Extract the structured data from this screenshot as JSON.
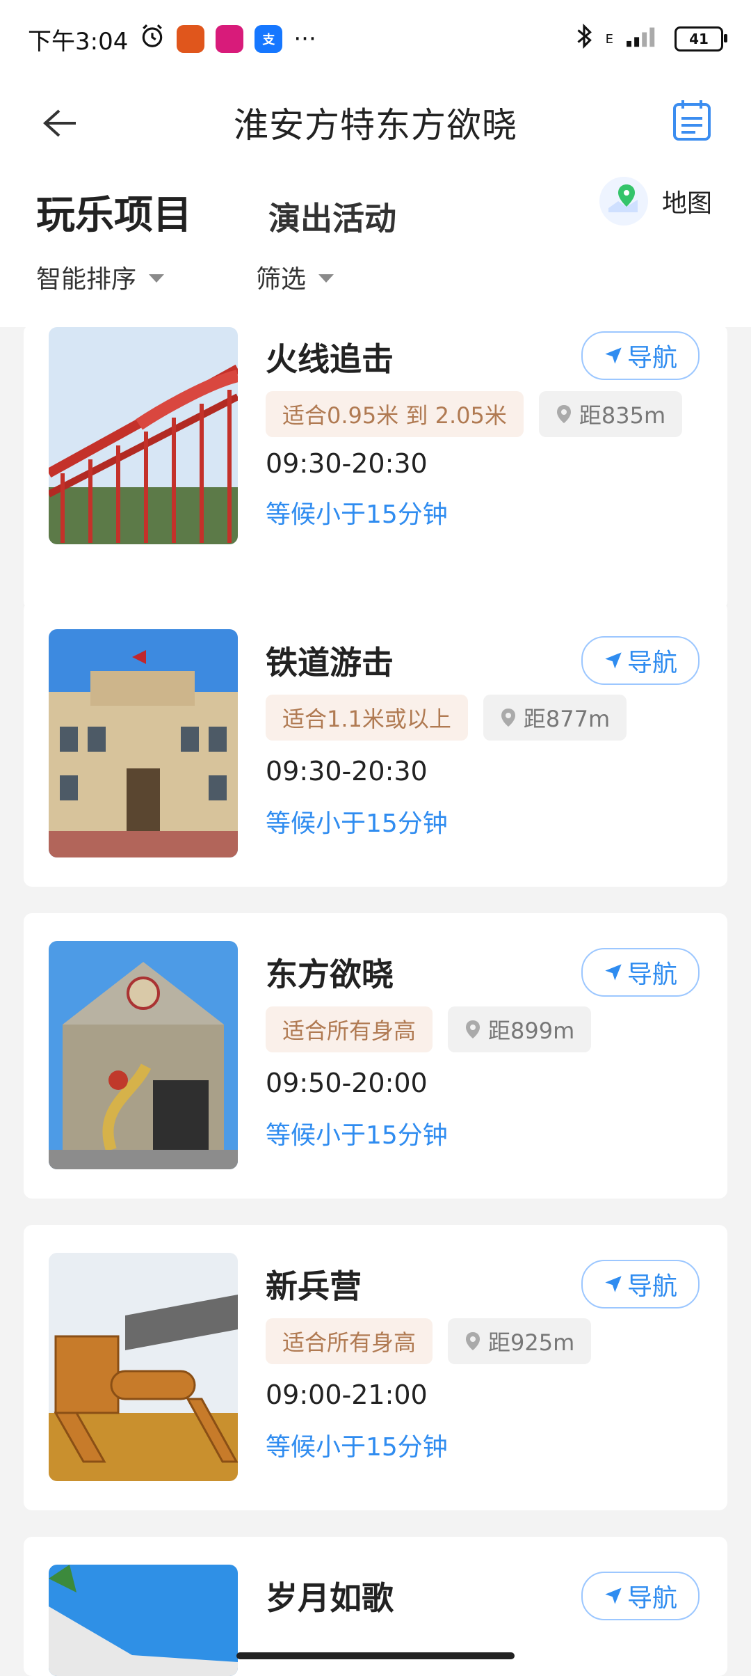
{
  "status_bar": {
    "time": "下午3:04",
    "battery": "41",
    "network": "E",
    "icons": [
      "alarm-icon",
      "pumpkin-app-icon",
      "vip-app-icon",
      "alipay-icon",
      "more-dots-icon",
      "bluetooth-icon",
      "signal-icon",
      "battery-icon"
    ],
    "more": "···"
  },
  "header": {
    "title": "淮安方特东方欲晓"
  },
  "tabs": {
    "primary": "玩乐项目",
    "secondary": "演出活动",
    "map_label": "地图"
  },
  "filters": {
    "sort": "智能排序",
    "filter": "筛选"
  },
  "nav_label": "导航",
  "items": [
    {
      "name": "火线追击",
      "height": "适合0.95米 到 2.05米",
      "distance": "距835m",
      "time": "09:30-20:30",
      "wait": "等候小于15分钟"
    },
    {
      "name": "铁道游击",
      "height": "适合1.1米或以上",
      "distance": "距877m",
      "time": "09:30-20:30",
      "wait": "等候小于15分钟"
    },
    {
      "name": "东方欲晓",
      "height": "适合所有身高",
      "distance": "距899m",
      "time": "09:50-20:00",
      "wait": "等候小于15分钟"
    },
    {
      "name": "新兵营",
      "height": "适合所有身高",
      "distance": "距925m",
      "time": "09:00-21:00",
      "wait": "等候小于15分钟"
    },
    {
      "name": "岁月如歌"
    }
  ],
  "colors": {
    "accent": "#2f8cf0",
    "height_tag_bg": "#faf0ea",
    "height_tag_text": "#b07a52",
    "dist_tag_bg": "#f1f1f1"
  }
}
